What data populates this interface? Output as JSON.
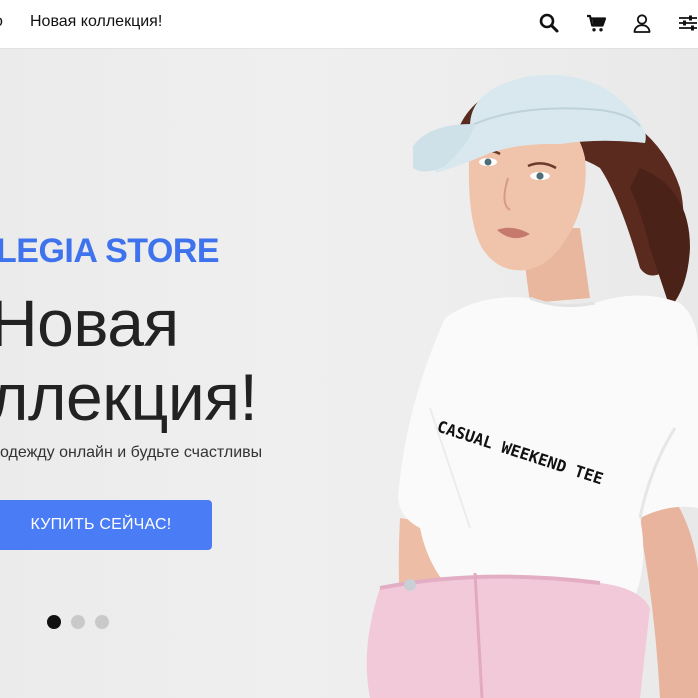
{
  "header": {
    "nav_cut": "о",
    "nav_link": "Новая коллекция!",
    "icons": [
      "search-icon",
      "cart-icon",
      "user-icon",
      "filter-sliders-icon"
    ]
  },
  "hero": {
    "brand": "LEGIA STORE",
    "title_line1": "Новая",
    "title_line2": "ллекция!",
    "subtitle": "одежду онлайн и будьте счастливы",
    "cta_label": "КУПИТЬ СЕЙЧАС!",
    "tee_print": "CASUAL WEEKEND TEE",
    "slides_total": 3,
    "slide_active": 1
  },
  "colors": {
    "accent": "#3f73ee",
    "button": "#4a7cf5",
    "text": "#222222"
  }
}
